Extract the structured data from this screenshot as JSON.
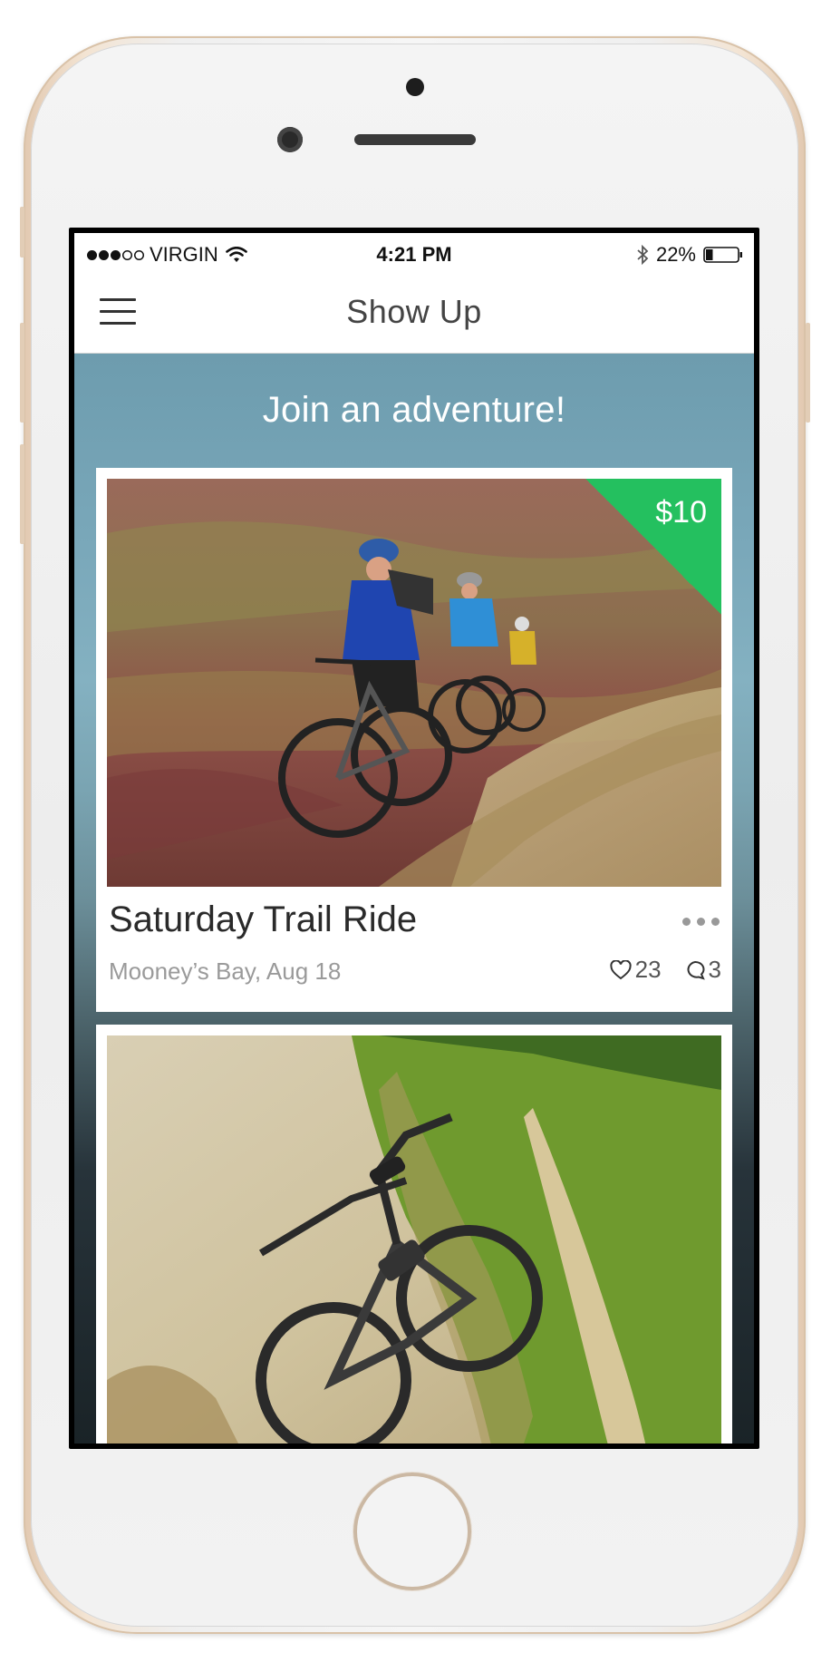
{
  "status_bar": {
    "carrier": "VIRGIN",
    "time": "4:21 PM",
    "battery": "22%",
    "battery_level": 0.22,
    "signal_bars_filled": 3,
    "signal_bars_total": 5
  },
  "nav": {
    "title": "Show Up",
    "menu_icon": "hamburger-icon"
  },
  "feed": {
    "heading": "Join an adventure!",
    "cards": [
      {
        "price": "$10",
        "title": "Saturday Trail Ride",
        "subtitle": "Mooney’s Bay, Aug 18",
        "likes": "23",
        "comments": "3",
        "image_subject": "mountain bikers riding on a hillside trail"
      },
      {
        "image_subject": "mountain bike lying on a rocky dirt trail"
      }
    ]
  },
  "colors": {
    "price_tag": "#24c05f",
    "header_bg": "#ffffff",
    "feed_gradient_top": "#6d9cae",
    "feed_gradient_bottom": "#1a2327"
  }
}
